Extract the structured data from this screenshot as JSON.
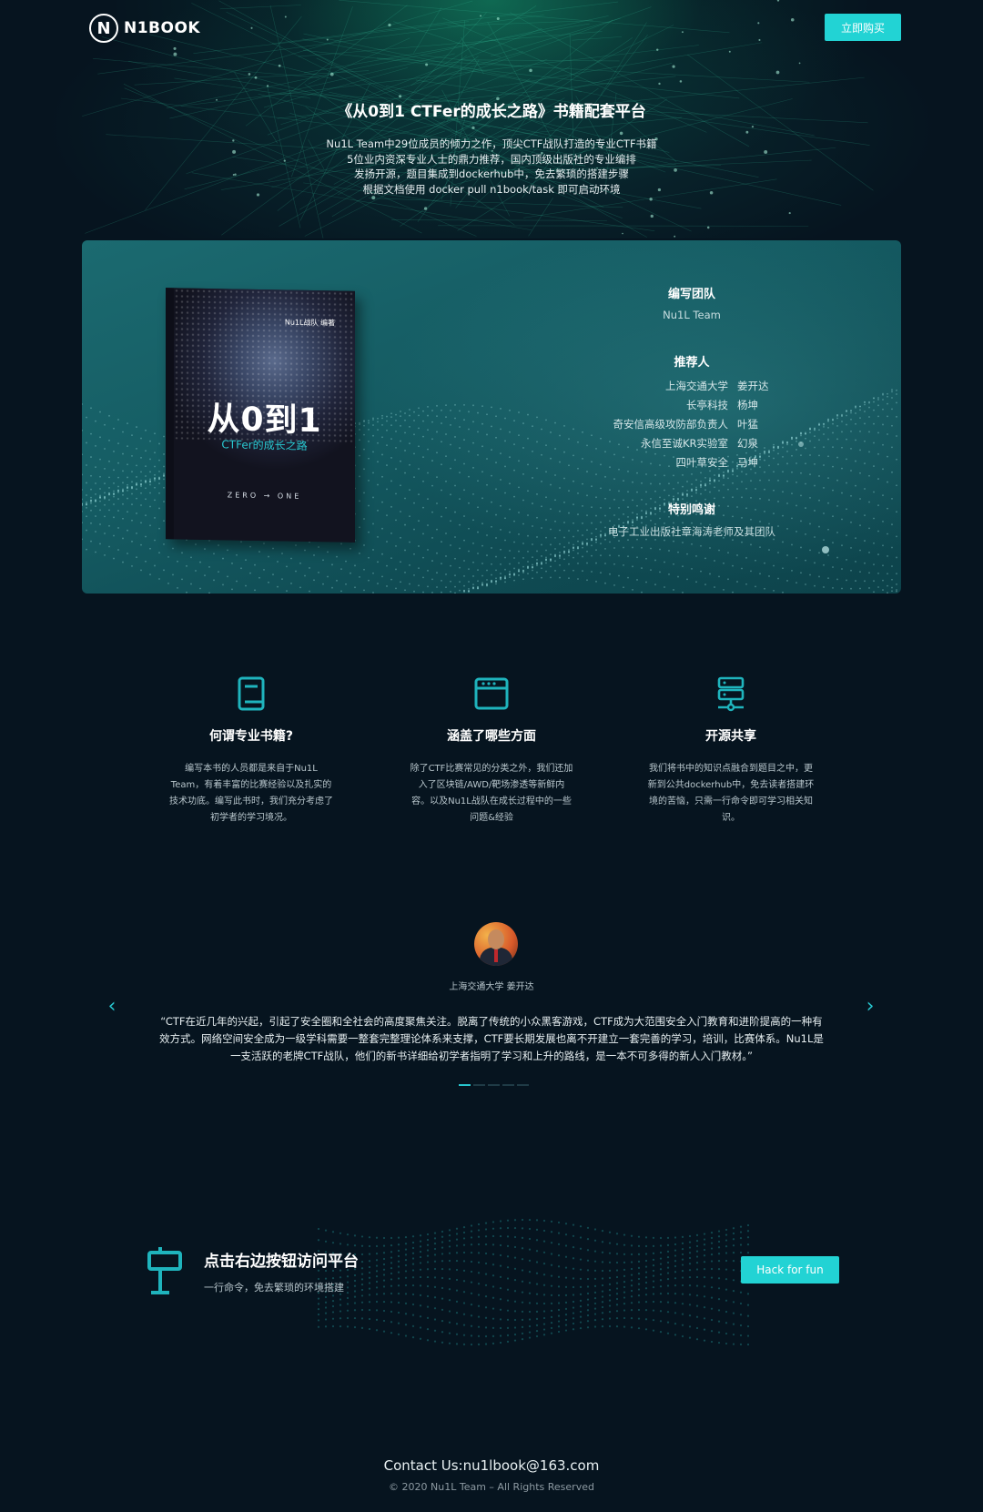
{
  "header": {
    "logo_mark": "N",
    "logo_text": "N1BOOK",
    "buy_label": "立即购买"
  },
  "hero": {
    "title": "《从0到1 CTFer的成长之路》书籍配套平台",
    "lines": [
      "Nu1L Team中29位成员的倾力之作，顶尖CTF战队打造的专业CTF书籍",
      "5位业内资深专业人士的鼎力推荐，国内顶级出版社的专业编排",
      "发扬开源，题目集成到dockerhub中，免去繁琐的搭建步骤",
      "根据文档使用 docker pull n1book/task 即可启动环境"
    ]
  },
  "book": {
    "title": "从0到1",
    "subtitle": "CTFer的成长之路",
    "zero_one": "ZERO → ONE",
    "publisher": "Nu1L战队 编著"
  },
  "credits": {
    "team_heading": "编写团队",
    "team_name": "Nu1L Team",
    "rec_heading": "推荐人",
    "recommenders": [
      {
        "org": "上海交通大学",
        "name": "姜开达"
      },
      {
        "org": "长亭科技",
        "name": "杨坤"
      },
      {
        "org": "奇安信高级攻防部负责人",
        "name": "叶猛"
      },
      {
        "org": "永信至诚KR实验室",
        "name": "幻泉"
      },
      {
        "org": "四叶草安全",
        "name": "马坤"
      }
    ],
    "thanks_heading": "特别鸣谢",
    "thanks_text": "电子工业出版社章海涛老师及其团队"
  },
  "features": [
    {
      "icon": "book-icon",
      "title": "何谓专业书籍?",
      "lines": [
        "编写本书的人员都是来自于Nu1L",
        "Team，有着丰富的比赛经验以及扎实的",
        "技术功底。编写此书时，我们充分考虑了",
        "初学者的学习境况。"
      ]
    },
    {
      "icon": "browser-window-icon",
      "title": "涵盖了哪些方面",
      "lines": [
        "除了CTF比赛常见的分类之外，我们还加",
        "入了区块链/AWD/靶场渗透等新鲜内",
        "容。以及Nu1L战队在成长过程中的一些",
        "问题&经验"
      ]
    },
    {
      "icon": "server-icon",
      "title": "开源共享",
      "lines": [
        "我们将书中的知识点融合到题目之中，更",
        "新到公共dockerhub中，免去读者搭建环",
        "境的苦恼，只需一行命令即可学习相关知",
        "识。"
      ]
    }
  ],
  "testimonial": {
    "author": "上海交通大学 姜开达",
    "quote_lines": [
      "“CTF在近几年的兴起，引起了安全圈和全社会的高度聚焦关注。脱离了传统的小众黑客游戏，CTF成为大范围安全入门教育和进阶提高的一种有",
      "效方式。网络空间安全成为一级学科需要一整套完整理论体系来支撑，CTF要长期发展也离不开建立一套完善的学习，培训，比赛体系。Nu1L是",
      "一支活跃的老牌CTF战队，他们的新书详细给初学者指明了学习和上升的路线，是一本不可多得的新人入门教材。”"
    ],
    "prev_glyph": "‹",
    "next_glyph": "›",
    "slide_count": 5,
    "active_slide": 1
  },
  "cta": {
    "title": "点击右边按钮访问平台",
    "subtitle": "一行命令，免去繁琐的环境搭建",
    "button_label": "Hack for fun"
  },
  "footer": {
    "contact": "Contact Us:nu1lbook@163.com",
    "copyright": "© 2020 Nu1L Team – All Rights Reserved"
  },
  "colors": {
    "accent": "#22d3d4",
    "background": "#06141f",
    "card": "#155c63"
  }
}
